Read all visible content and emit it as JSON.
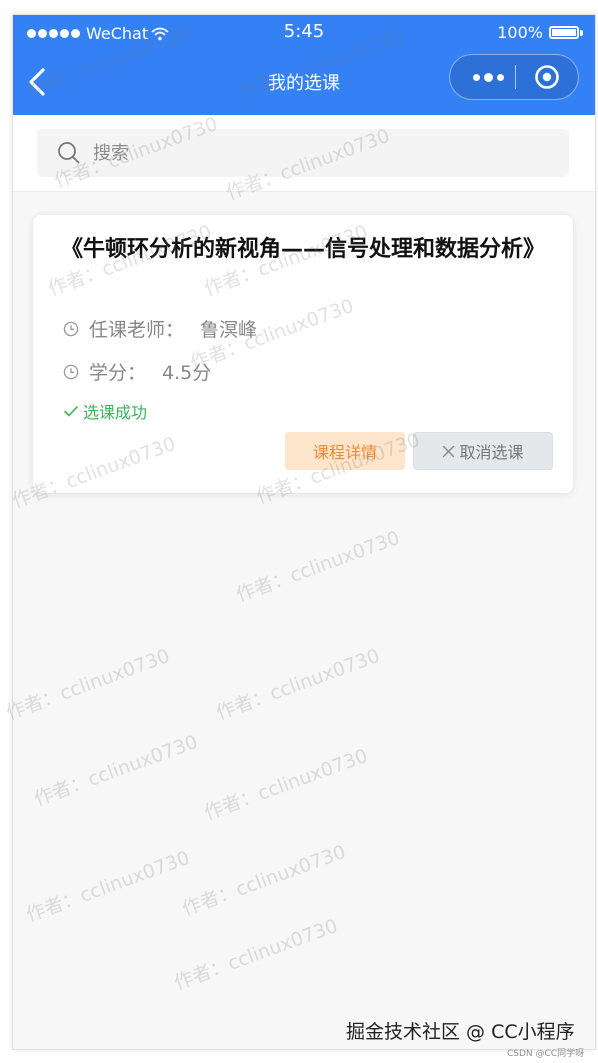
{
  "status_bar": {
    "carrier": "WeChat",
    "time": "5:45",
    "battery": "100%"
  },
  "nav": {
    "title": "我的选课"
  },
  "search": {
    "placeholder": "搜索"
  },
  "course": {
    "title": "《牛顿环分析的新视角——信号处理和数据分析》",
    "teacher_label": "任课老师：",
    "teacher": "鲁溟峰",
    "credit_label": "学分：",
    "credit": "4.5分",
    "status": "选课成功",
    "detail_button": "课程详情",
    "cancel_button": "取消选课"
  },
  "watermark": "作者：cclinux0730",
  "footer": {
    "brand": "掘金技术社区 @ CC小程序",
    "sub": "CSDN @CC同学呀"
  },
  "colors": {
    "primary": "#3481f6",
    "success": "#3bb35a",
    "detail_bg": "#fde5cb",
    "detail_text": "#ee8b3a",
    "cancel_bg": "#e5e8ea"
  }
}
